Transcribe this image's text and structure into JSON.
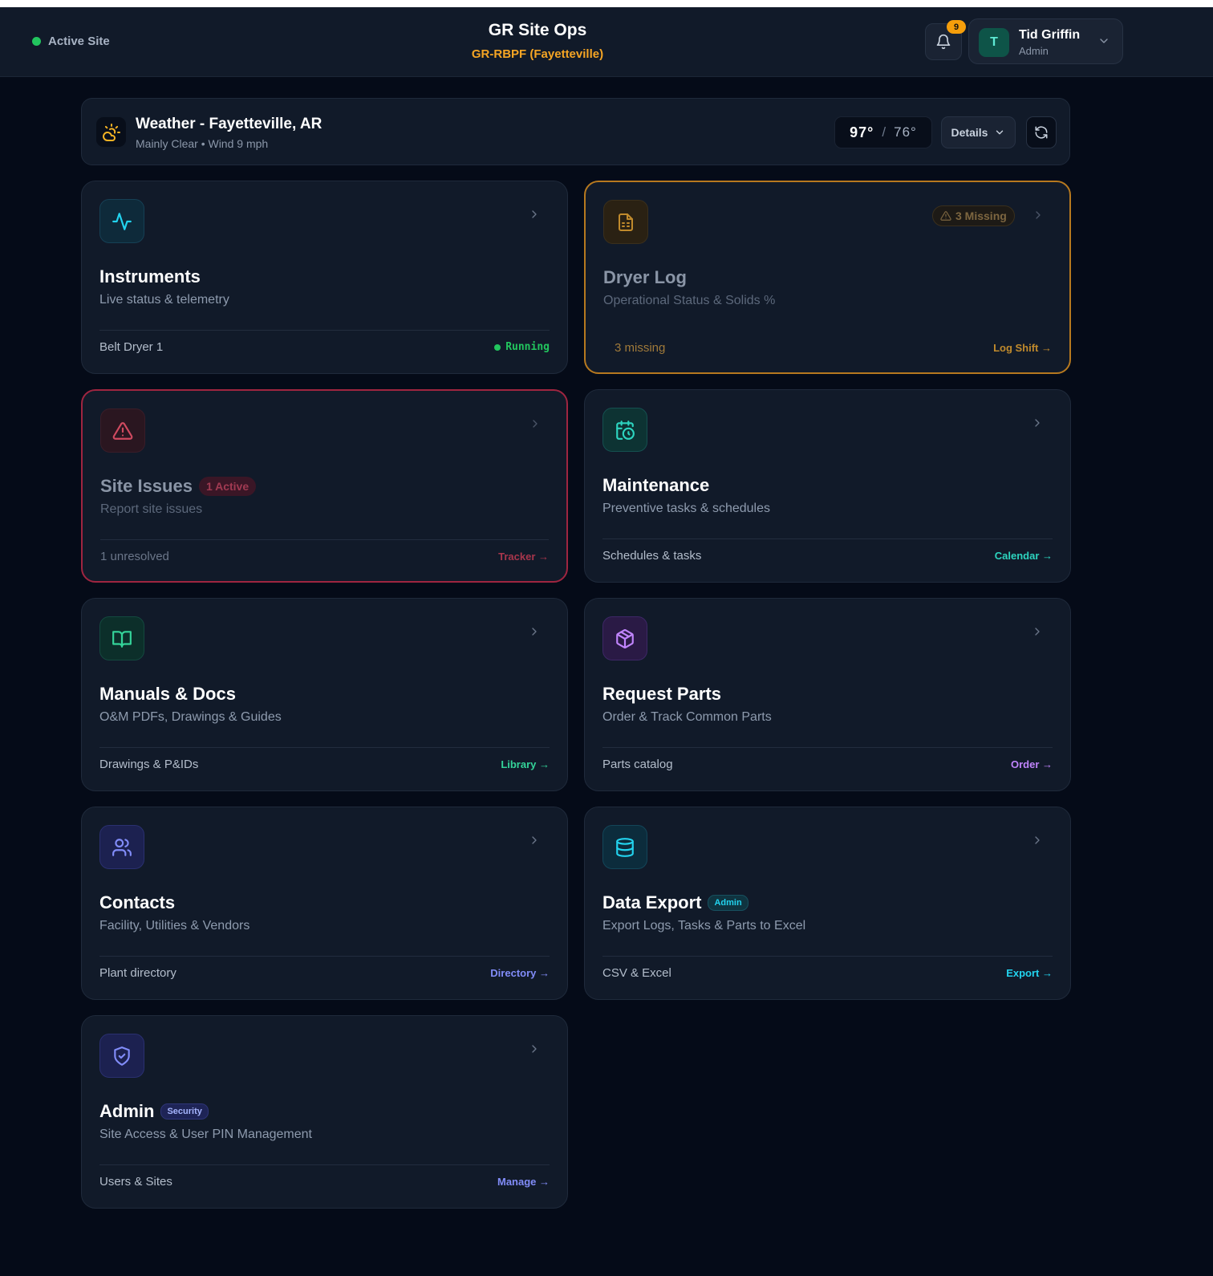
{
  "header": {
    "site_status": "Active Site",
    "app_title": "GR Site Ops",
    "site_name": "GR-RBPF (Fayetteville)",
    "notification_count": "9",
    "user": {
      "initial": "T",
      "name": "Tid Griffin",
      "role": "Admin"
    }
  },
  "weather": {
    "title": "Weather - Fayetteville, AR",
    "summary": "Mainly Clear • Wind 9 mph",
    "high": "97°",
    "separator": "/",
    "low": "76°",
    "details_label": "Details"
  },
  "cards": {
    "instruments": {
      "title": "Instruments",
      "desc": "Live status & telemetry",
      "foot_left": "Belt Dryer 1",
      "foot_right": "Running"
    },
    "dryer_log": {
      "title": "Dryer Log",
      "desc": "Operational Status & Solids %",
      "badge": "3 Missing",
      "foot_left": "3 missing",
      "foot_right": "Log Shift →"
    },
    "site_issues": {
      "title": "Site Issues",
      "badge": "1 Active",
      "desc": "Report site issues",
      "foot_left": "1 unresolved",
      "foot_right": "Tracker →"
    },
    "maintenance": {
      "title": "Maintenance",
      "desc": "Preventive tasks & schedules",
      "foot_left": "Schedules & tasks",
      "foot_right": "Calendar →"
    },
    "manuals": {
      "title": "Manuals & Docs",
      "desc": "O&M PDFs, Drawings & Guides",
      "foot_left": "Drawings & P&IDs",
      "foot_right": "Library →"
    },
    "parts": {
      "title": "Request Parts",
      "desc": "Order & Track Common Parts",
      "foot_left": "Parts catalog",
      "foot_right": "Order →"
    },
    "contacts": {
      "title": "Contacts",
      "desc": "Facility, Utilities & Vendors",
      "foot_left": "Plant directory",
      "foot_right": "Directory →"
    },
    "data_export": {
      "title": "Data Export",
      "badge": "Admin",
      "desc": "Export Logs, Tasks & Parts to Excel",
      "foot_left": "CSV & Excel",
      "foot_right": "Export →"
    },
    "admin": {
      "title": "Admin",
      "badge": "Security",
      "desc": "Site Access & User PIN Management",
      "foot_left": "Users & Sites",
      "foot_right": "Manage →"
    }
  },
  "colors": {
    "background": "#050b18",
    "card": "#111a29",
    "status_green": "#22c55e",
    "site_amber": "#f5a524",
    "warn_border": "#b7791f",
    "danger_border": "#9f2540",
    "teal": "#2dd4bf",
    "green": "#34d399",
    "purple": "#c084fc",
    "indigo": "#818cf8",
    "cyan": "#22d3ee"
  },
  "icons": {
    "weather": "partly-sunny-icon",
    "instruments": "activity-pulse-icon",
    "dryer_log": "spreadsheet-file-icon",
    "site_issues": "warning-triangle-icon",
    "maintenance": "calendar-clock-icon",
    "manuals": "open-book-icon",
    "parts": "package-box-icon",
    "contacts": "users-icon",
    "data_export": "database-icon",
    "admin": "shield-check-icon"
  }
}
